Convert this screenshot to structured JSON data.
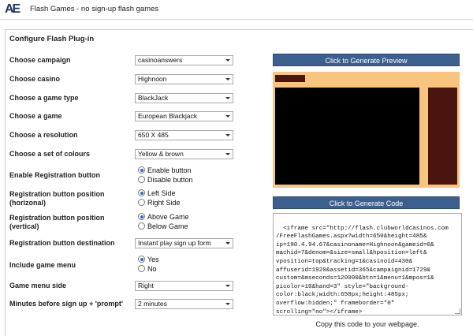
{
  "app": {
    "logo_text": "AE",
    "title": "Flash Games - no sign-up flash games"
  },
  "panel": {
    "title": "Configure Flash Plug-in"
  },
  "fields": {
    "campaign": {
      "label": "Choose campaign",
      "value": "casinoanswers"
    },
    "casino": {
      "label": "Choose casino",
      "value": "Highnoon"
    },
    "game_type": {
      "label": "Choose a game type",
      "value": "BlackJack"
    },
    "game": {
      "label": "Choose a game",
      "value": "European Blackjack"
    },
    "resolution": {
      "label": "Choose a resolution",
      "value": "650 X 485"
    },
    "colours": {
      "label": "Choose a set of colours",
      "value": "Yellow & brown"
    },
    "reg_enable": {
      "label": "Enable Registration button",
      "options": [
        "Enable button",
        "Disable button"
      ],
      "selected": 0
    },
    "reg_pos_h": {
      "label_line1": "Registration button position",
      "label_line2": "(horizonal)",
      "options": [
        "Left Side",
        "Right Side"
      ],
      "selected": 0
    },
    "reg_pos_v": {
      "label_line1": "Registration button position",
      "label_line2": "(vertical)",
      "options": [
        "Above Game",
        "Below Game"
      ],
      "selected": 0
    },
    "reg_dest": {
      "label": "Registration button destination",
      "value": "Instant play sign up form"
    },
    "game_menu": {
      "label": "Include game menu",
      "options": [
        "Yes",
        "No"
      ],
      "selected": 0
    },
    "menu_side": {
      "label": "Game menu side",
      "value": "Right"
    },
    "minutes": {
      "label": "Minutes before sign up + 'prompt'",
      "value": "2 minutes"
    }
  },
  "buttons": {
    "preview": "Click to Generate Preview",
    "code": "Click to Generate Code"
  },
  "preview_colors": {
    "background": "#f8c47e",
    "accent": "#4a150f",
    "game": "#000000"
  },
  "code": {
    "text": "<iframe src=\"http://flash.clubworldcasinos.com\n/FreeFlashGames.aspx?width=650&height=485&\nip=190.4.94.67&casinoname=Highnoon&gameid=0&\nmachid=7&denom=&size=small&hposition=left&\nvposition=top&tracking=1&casinoid=430&\naffuserid=1920&assetid=365&campaignid=1729&\ncustom=&mseconds=120000&btn=1&menu=1&mpos=1&\npicolor=10&hand=3\" style=\"background-\ncolor:black;width:650px;height:485px;\noverflow:hidden;\" frameborder=\"0\"\nscrolling=\"no\"></iframe>",
    "note": "Copy this code to your webpage."
  }
}
